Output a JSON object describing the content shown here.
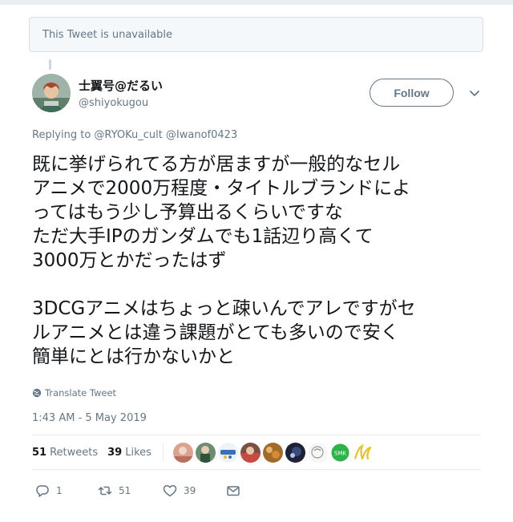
{
  "notice": {
    "text": "This Tweet is unavailable"
  },
  "user": {
    "display_name": "士翼号@だるい",
    "handle": "@shiyokugou"
  },
  "follow_button": {
    "label": "Follow"
  },
  "reply_context": {
    "text": "Replying to @RYOKu_cult @Iwanof0423"
  },
  "tweet": {
    "text": "既に挙げられてる方が居ますが一般的なセル\nアニメで2000万程度・タイトルブランドによ\nってはもう少し予算出るくらいですな\nただ大手IPのガンダムでも1話辺り高くて\n3000万とかだったはず\n\n3DCGアニメはちょっと疎いんでアレですがセ\nルアニメとは違う課題がとても多いので安く\n簡単にとは行かないかと"
  },
  "translate": {
    "label": "Translate Tweet",
    "icon": "globe-icon"
  },
  "timestamp": "1:43 AM - 5 May 2019",
  "stats": {
    "retweets_count": "51",
    "retweets_label": "Retweets",
    "likes_count": "39",
    "likes_label": "Likes"
  },
  "likers_count_visible": 9,
  "actions": {
    "reply_count": "1",
    "retweet_count": "51",
    "like_count": "39"
  },
  "colors": {
    "secondary_text": "#657786",
    "primary_text": "#14171a",
    "border": "#e6ecf0"
  }
}
